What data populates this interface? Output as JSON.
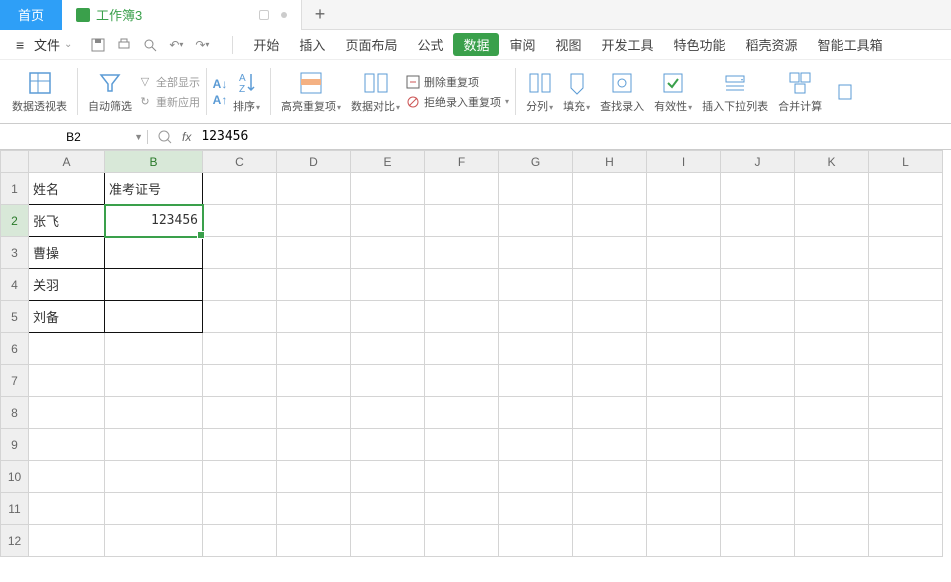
{
  "tabs": {
    "home": "首页",
    "doc_title": "工作簿3",
    "add": "+"
  },
  "menu": {
    "file": "文件",
    "items": [
      "开始",
      "插入",
      "页面布局",
      "公式",
      "数据",
      "审阅",
      "视图",
      "开发工具",
      "特色功能",
      "稻壳资源",
      "智能工具箱"
    ],
    "active_index": 4
  },
  "ribbon": {
    "pivot": "数据透视表",
    "autofilter": "自动筛选",
    "show_all": "全部显示",
    "reapply": "重新应用",
    "sort": "排序",
    "highlight_dup": "高亮重复项",
    "data_compare": "数据对比",
    "remove_dup": "删除重复项",
    "reject_dup": "拒绝录入重复项",
    "text_to_cols": "分列",
    "fill": "填充",
    "lookup": "查找录入",
    "validation": "有效性",
    "dropdown": "插入下拉列表",
    "consolidate": "合并计算"
  },
  "formula_bar": {
    "cell_ref": "B2",
    "fx": "fx",
    "value": "123456"
  },
  "grid": {
    "columns": [
      "A",
      "B",
      "C",
      "D",
      "E",
      "F",
      "G",
      "H",
      "I",
      "J",
      "K",
      "L"
    ],
    "rows": 12,
    "active_col": 1,
    "active_row": 1,
    "data": {
      "r1": [
        "姓名",
        "准考证号"
      ],
      "r2": [
        "张飞",
        "123456"
      ],
      "r3": [
        "曹操",
        ""
      ],
      "r4": [
        "关羽",
        ""
      ],
      "r5": [
        "刘备",
        ""
      ]
    },
    "bordered_region": {
      "rows": [
        0,
        1,
        2,
        3,
        4
      ],
      "cols": [
        0,
        1
      ]
    }
  },
  "chart_data": {
    "type": "table",
    "title": "",
    "columns": [
      "姓名",
      "准考证号"
    ],
    "rows": [
      [
        "张飞",
        123456
      ],
      [
        "曹操",
        null
      ],
      [
        "关羽",
        null
      ],
      [
        "刘备",
        null
      ]
    ]
  }
}
